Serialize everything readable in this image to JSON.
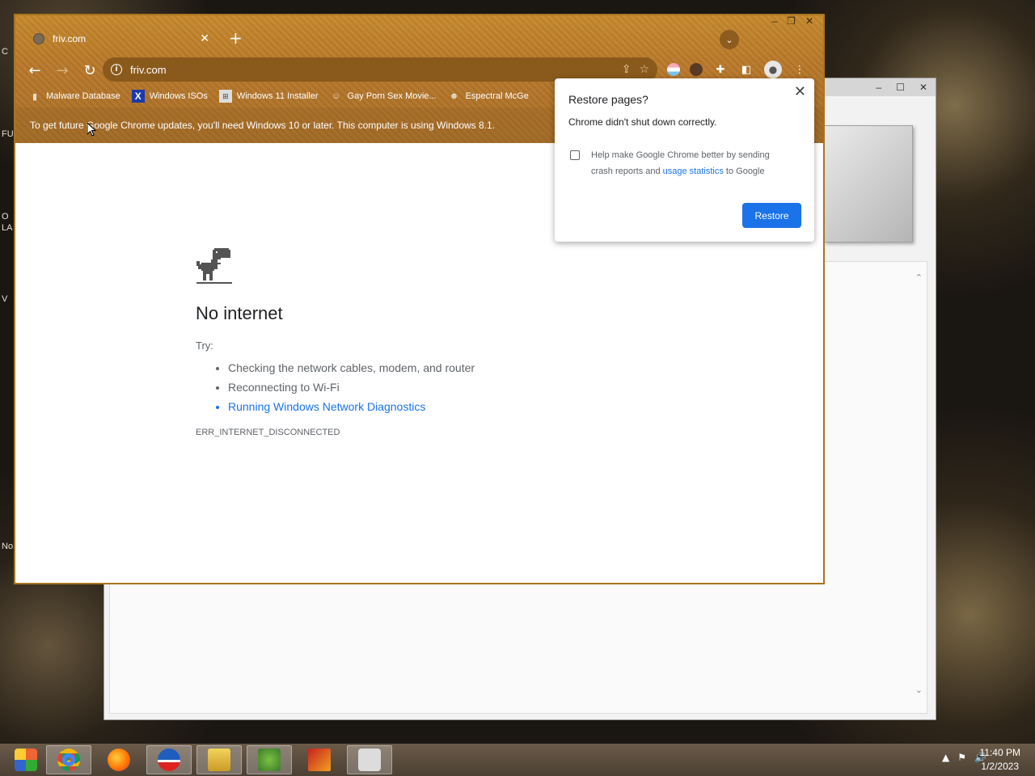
{
  "desktop": {
    "fragments": [
      "FU",
      "O",
      "LA",
      "V",
      "No",
      "C"
    ]
  },
  "background_window": {
    "controls": [
      "–",
      "☐",
      "✕"
    ]
  },
  "chrome": {
    "tab": {
      "title": "friv.com",
      "close": "✕"
    },
    "new_tab": "+",
    "tab_search": "⌄",
    "window_controls": [
      "–",
      "❐",
      "✕"
    ],
    "toolbar": {
      "back": "←",
      "forward": "→",
      "reload": "↻",
      "url": "friv.com",
      "share_icon": "⇪",
      "star_icon": "☆",
      "extensions_icon": "✚",
      "sidepanel_icon": "◧",
      "menu_icon": "⋮"
    },
    "bookmarks": [
      {
        "label": "Malware Database",
        "icon": "folder-icon"
      },
      {
        "label": "Windows ISOs",
        "icon": "x-icon"
      },
      {
        "label": "Windows 11 Installer",
        "icon": "windows-icon"
      },
      {
        "label": "Gay Porn Sex Movie...",
        "icon": "ghost-icon"
      },
      {
        "label": "Espectral McGe",
        "icon": "face-icon"
      }
    ],
    "infobar": "To get future Google Chrome updates, you'll need Windows 10 or later. This computer is using Windows 8.1.",
    "error_page": {
      "title": "No internet",
      "try": "Try:",
      "suggestions": [
        "Checking the network cables, modem, and router",
        "Reconnecting to Wi-Fi",
        "Running Windows Network Diagnostics"
      ],
      "code": "ERR_INTERNET_DISCONNECTED"
    }
  },
  "restore_popup": {
    "title": "Restore pages?",
    "message": "Chrome didn't shut down correctly.",
    "help_prefix": "Help make Google Chrome better by sending crash reports and ",
    "help_link": "usage statistics",
    "help_suffix": " to Google",
    "button": "Restore",
    "close": "✕"
  },
  "taskbar": {
    "apps": [
      "start",
      "chrome",
      "firefox",
      "obama",
      "file-explorer",
      "people",
      "red-app",
      "game-controller"
    ],
    "tray": [
      "▲",
      "⚑",
      "🔊"
    ],
    "time": "11:40 PM",
    "date": "1/2/2023"
  }
}
